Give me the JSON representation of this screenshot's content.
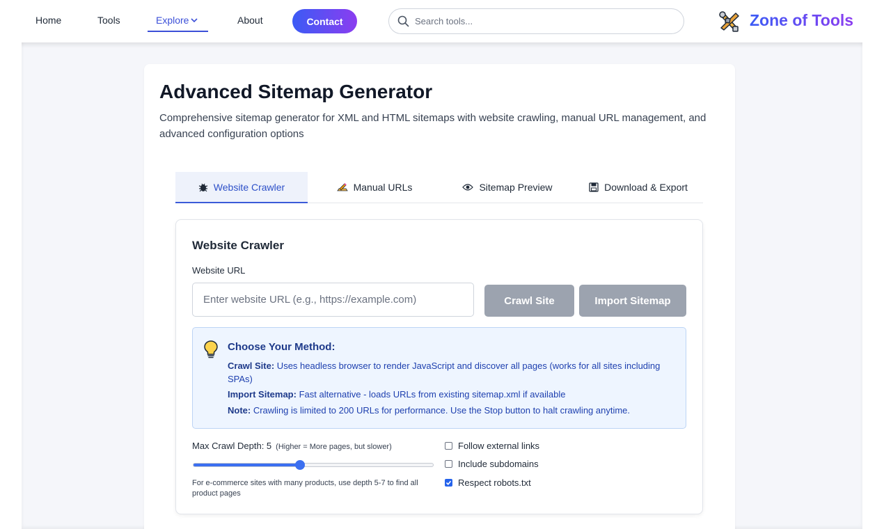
{
  "nav": {
    "home": "Home",
    "tools": "Tools",
    "explore": "Explore",
    "about": "About",
    "contact": "Contact"
  },
  "search": {
    "placeholder": "Search tools..."
  },
  "brand": {
    "name": "Zone of Tools"
  },
  "page": {
    "title": "Advanced Sitemap Generator",
    "description": "Comprehensive sitemap generator for XML and HTML sitemaps with website crawling, manual URL management, and advanced configuration options"
  },
  "tabs": [
    {
      "label": "Website Crawler",
      "icon": "bug-icon",
      "active": true
    },
    {
      "label": "Manual URLs",
      "icon": "pencil-icon",
      "active": false
    },
    {
      "label": "Sitemap Preview",
      "icon": "eye-icon",
      "active": false
    },
    {
      "label": "Download & Export",
      "icon": "save-icon",
      "active": false
    }
  ],
  "crawler": {
    "title": "Website Crawler",
    "url_label": "Website URL",
    "url_placeholder": "Enter website URL (e.g., https://example.com)",
    "crawl_button": "Crawl Site",
    "import_button": "Import Sitemap",
    "info": {
      "title": "Choose Your Method:",
      "crawl_term": "Crawl Site:",
      "crawl_text": " Uses headless browser to render JavaScript and discover all pages (works for all sites including SPAs)",
      "import_term": "Import Sitemap:",
      "import_text": " Fast alternative - loads URLs from existing sitemap.xml if available",
      "note_term": "Note:",
      "note_text": " Crawling is limited to 200 URLs for performance. Use the Stop button to halt crawling anytime."
    },
    "depth": {
      "label": "Max Crawl Depth: 5",
      "hint": "(Higher = More pages, but slower)",
      "value": 5,
      "min": 1,
      "max": 10,
      "note": "For e-commerce sites with many products, use depth 5-7 to find all product pages"
    },
    "options": [
      {
        "label": "Follow external links",
        "checked": false
      },
      {
        "label": "Include subdomains",
        "checked": false
      },
      {
        "label": "Respect robots.txt",
        "checked": true
      }
    ]
  },
  "colors": {
    "accent": "#3b5bd8",
    "gradient_start": "#3b5bf5",
    "gradient_end": "#8b3df0",
    "button_disabled": "#9ca3af",
    "info_bg": "#eef5ff"
  }
}
